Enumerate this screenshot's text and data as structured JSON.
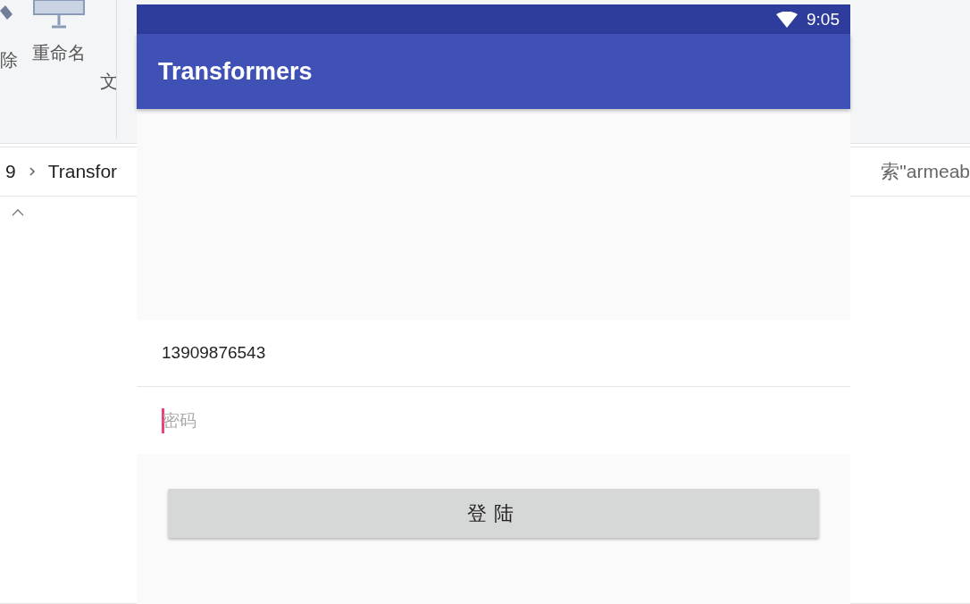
{
  "explorer": {
    "ribbon": [
      {
        "label": "除",
        "kind": "delete"
      },
      {
        "label": "重命名",
        "kind": "rename"
      },
      {
        "label": "文",
        "kind": "none"
      }
    ],
    "path": [
      "9",
      "Transfor"
    ],
    "search": {
      "placeholder": "索\"armeab"
    }
  },
  "emulator": {
    "status_bar": {
      "time": "9:05"
    },
    "app_bar": {
      "title": "Transformers"
    },
    "phone_field": {
      "value": "13909876543"
    },
    "password_field": {
      "placeholder": "密码",
      "focused": true
    },
    "login_button": {
      "label": "登陆"
    }
  }
}
